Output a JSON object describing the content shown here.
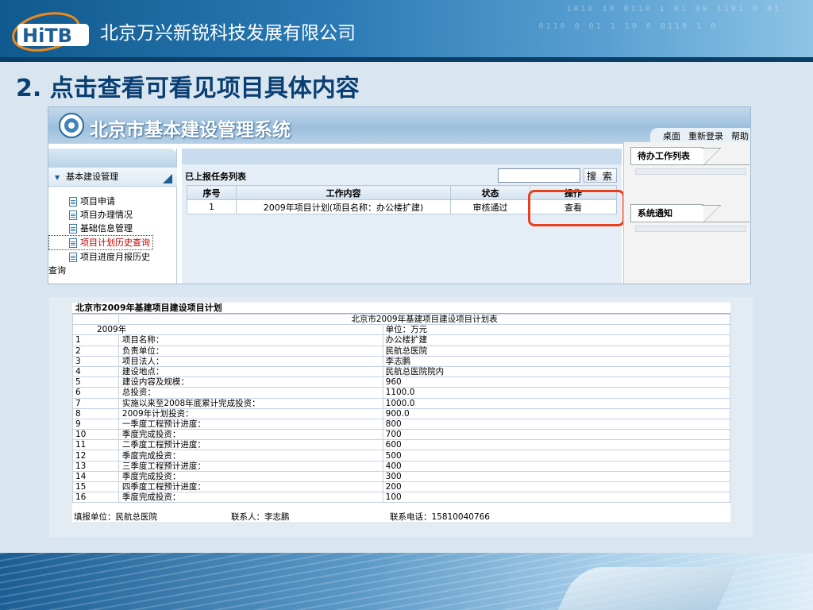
{
  "slide": {
    "company_name": "北京万兴新锐科技发展有限公司",
    "logo_text": "HiTB",
    "step_title": "2.  点击查看可看见项目具体内容"
  },
  "app": {
    "system_title": "北京市基本建设管理系统",
    "top_nav": [
      "桌面",
      "重新登录",
      "帮助"
    ],
    "left_menu": {
      "header": "基本建设管理",
      "items": [
        "项目申请",
        "项目办理情况",
        "基础信息管理",
        "项目计划历史查询",
        "项目进度月报历史"
      ],
      "wrap_text": "查询"
    },
    "task_list": {
      "title": "已上报任务列表",
      "search_value": "",
      "search_button": "搜 索",
      "columns": [
        "序号",
        "工作内容",
        "状态",
        "操作"
      ],
      "rows": [
        {
          "no": "1",
          "content": "2009年项目计划(项目名称：办公楼扩建)",
          "status": "审核通过",
          "action": "查看"
        }
      ]
    },
    "right_panel": {
      "todo_title": "待办工作列表",
      "notice_title": "系统通知"
    }
  },
  "plan": {
    "title": "北京市2009年基建项目建设项目计划",
    "table_title": "北京市2009年基建项目建设项目计划表",
    "year": "2009年",
    "unit": "单位：万元",
    "rows": [
      {
        "no": "1",
        "label": "项目名称：",
        "value": "办公楼扩建"
      },
      {
        "no": "2",
        "label": "负责单位：",
        "value": "民航总医院"
      },
      {
        "no": "3",
        "label": "项目法人：",
        "value": "李志鹏"
      },
      {
        "no": "4",
        "label": "建设地点：",
        "value": "民航总医院院内"
      },
      {
        "no": "5",
        "label": "建设内容及规模：",
        "value": "960"
      },
      {
        "no": "6",
        "label": "总投资：",
        "value": "1100.0"
      },
      {
        "no": "7",
        "label": "实施以来至2008年底累计完成投资：",
        "value": "1000.0"
      },
      {
        "no": "8",
        "label": "2009年计划投资：",
        "value": "900.0"
      },
      {
        "no": "9",
        "label": "一季度工程预计进度：",
        "value": "800"
      },
      {
        "no": "10",
        "label": "季度完成投资：",
        "value": "700"
      },
      {
        "no": "11",
        "label": "二季度工程预计进度：",
        "value": "600"
      },
      {
        "no": "12",
        "label": "季度完成投资：",
        "value": "500"
      },
      {
        "no": "13",
        "label": "三季度工程预计进度：",
        "value": "400"
      },
      {
        "no": "14",
        "label": "季度完成投资：",
        "value": "300"
      },
      {
        "no": "15",
        "label": "四季度工程预计进度：",
        "value": "200"
      },
      {
        "no": "16",
        "label": "季度完成投资：",
        "value": "100"
      }
    ],
    "footer": {
      "unit": "填报单位：民航总医院",
      "contact": "联系人：李志鹏",
      "phone": "联系电话：15810040766"
    }
  },
  "colors": {
    "highlight": "#e8401c",
    "title_blue": "#0a3f73",
    "active_menu": "#c00000"
  }
}
